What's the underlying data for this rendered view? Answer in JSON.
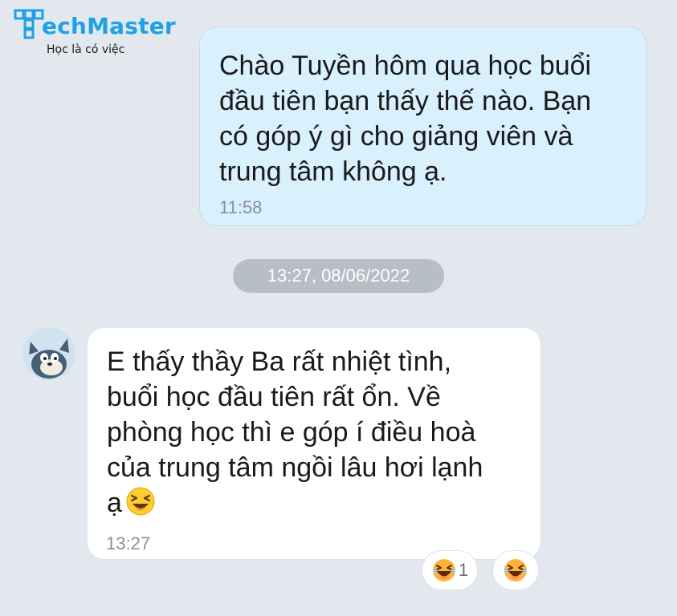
{
  "logo": {
    "brand_text": "echMaster",
    "tagline": "Học là có việc",
    "accent_color": "#1ea1e6"
  },
  "messages": [
    {
      "direction": "outgoing",
      "text": "Chào Tuyền hôm qua học buổi\nđầu tiên bạn thấy thế nào. Bạn\ncó góp ý gì cho giảng viên và\ntrung tâm không ạ.",
      "time": "11:58",
      "bubble_color": "#d9f0fd"
    },
    {
      "direction": "incoming",
      "text": "E thấy thầy Ba rất nhiệt tình,\nbuổi học đầu tiên rất ổn. Về\nphòng học thì e góp í điều hoà\ncủa trung tâm ngồi lâu hơi lạnh\nạ",
      "emoji": "laughing-squint-icon",
      "time": "13:27",
      "bubble_color": "#ffffff",
      "avatar": "tom-cat-avatar",
      "reactions": [
        {
          "icon": "laughing-face-icon",
          "count": "1"
        },
        {
          "icon": "laughing-face-icon",
          "count": ""
        }
      ]
    }
  ],
  "date_separator": "13:27, 08/06/2022",
  "colors": {
    "background": "#e3e8ef",
    "date_pill": "#b8bec6",
    "timestamp": "#8a8f96"
  }
}
